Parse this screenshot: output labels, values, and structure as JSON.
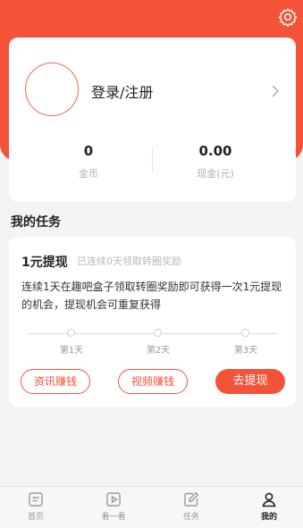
{
  "header": {
    "settings_icon": "gear-icon",
    "accent_color": "#f4533a"
  },
  "profile": {
    "login_label": "登录/注册",
    "chevron_icon": "chevron-right-icon",
    "stats": [
      {
        "value": "0",
        "label": "金币"
      },
      {
        "value": "0.00",
        "label": "现金(元)"
      }
    ]
  },
  "tasks": {
    "section_title": "我的任务",
    "card": {
      "title": "1元提现",
      "subtitle": "已连续0天领取转圈奖励",
      "description": "连续1天在趣吧盒子领取转圈奖励即可获得一次1元提现的机会，提现机会可重复获得",
      "days": [
        "第1天",
        "第2天",
        "第3天"
      ],
      "buttons": {
        "news": "资讯赚钱",
        "video": "视频赚钱",
        "withdraw": "去提现"
      }
    }
  },
  "tabbar": {
    "items": [
      {
        "label": "首页",
        "icon": "home-icon"
      },
      {
        "label": "看一看",
        "icon": "video-icon"
      },
      {
        "label": "任务",
        "icon": "edit-icon"
      },
      {
        "label": "我的",
        "icon": "person-icon"
      }
    ],
    "active": "我的"
  }
}
